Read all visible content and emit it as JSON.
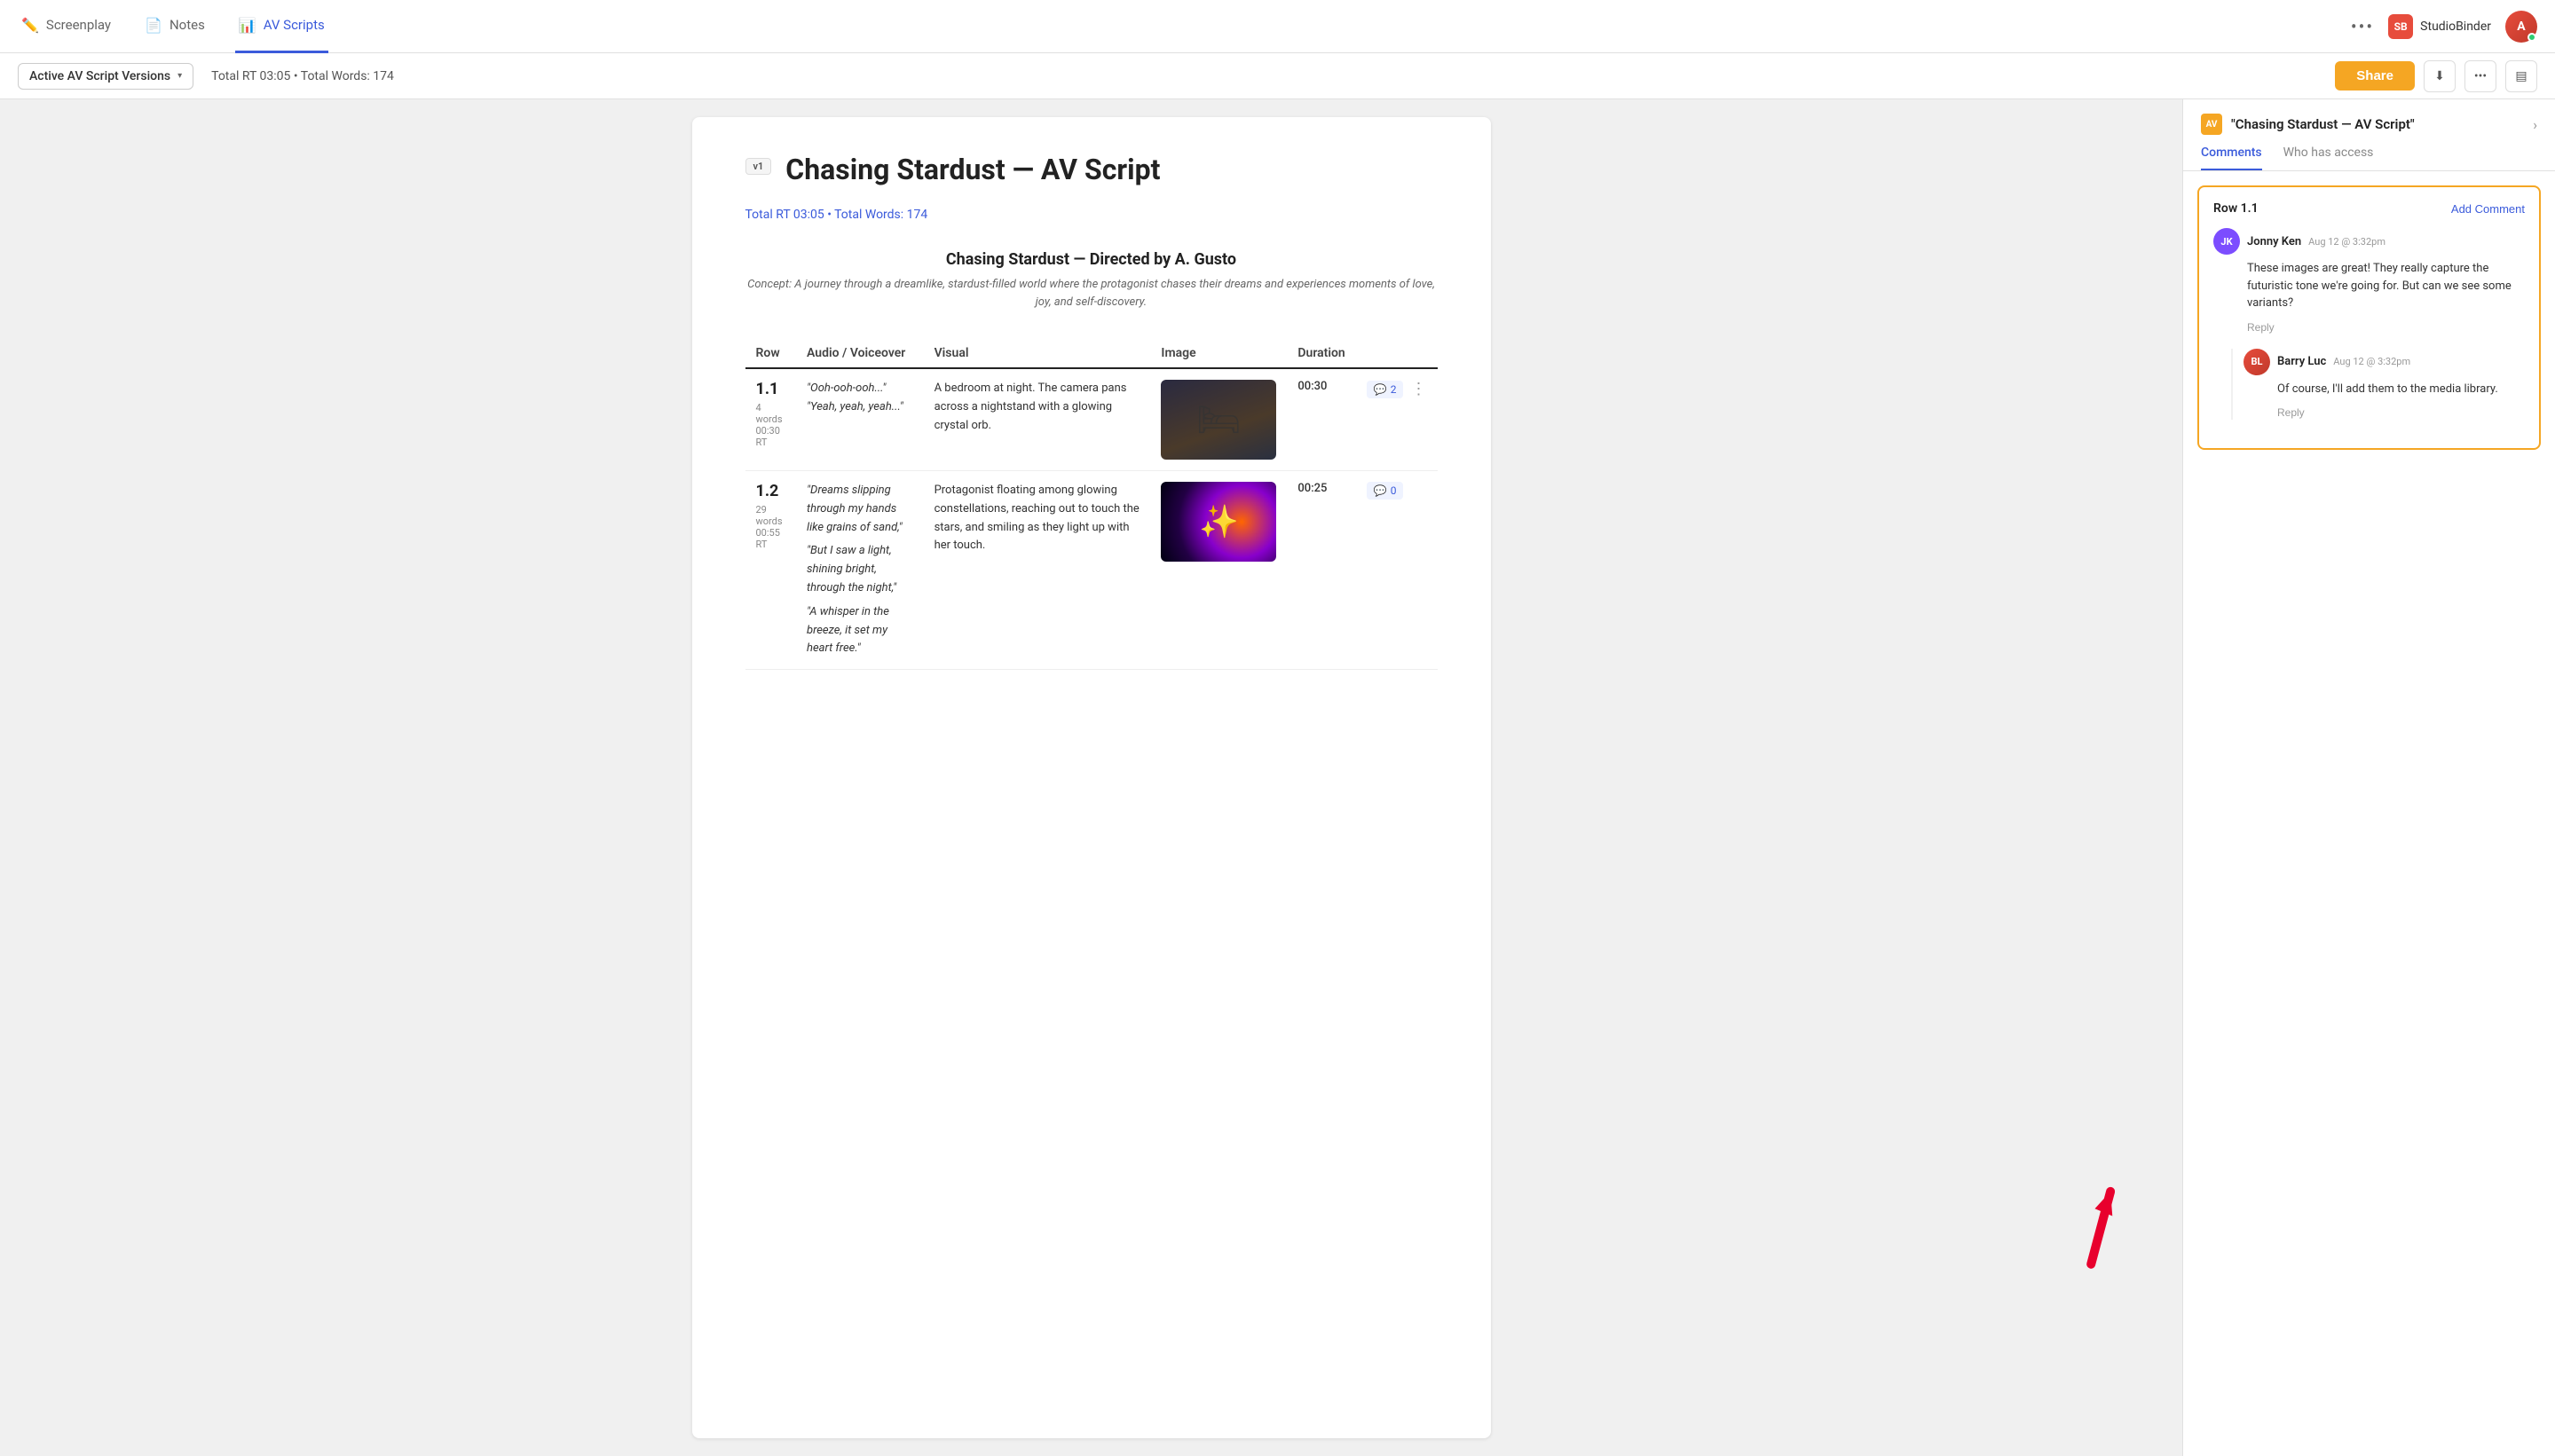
{
  "nav": {
    "tabs": [
      {
        "id": "screenplay",
        "label": "Screenplay",
        "icon": "✏️",
        "active": false
      },
      {
        "id": "notes",
        "label": "Notes",
        "icon": "📄",
        "active": false
      },
      {
        "id": "av-scripts",
        "label": "AV Scripts",
        "icon": "📊",
        "active": true
      }
    ],
    "more_label": "•••",
    "studio_binder_label": "StudioBinder"
  },
  "toolbar": {
    "version_label": "Active AV Script Versions",
    "rt_info": "Total RT 03:05 • Total Words: 174",
    "share_label": "Share",
    "download_icon": "⬇",
    "more_icon": "•••",
    "sidebar_icon": "▤"
  },
  "script": {
    "version_badge": "v1",
    "title": "Chasing Stardust — AV Script",
    "meta": "Total RT 03:05 • Total Words: 174",
    "subtitle_title": "Chasing Stardust — Directed by A. Gusto",
    "subtitle_concept": "Concept: A journey through a dreamlike, stardust-filled world where the protagonist chases their dreams and experiences\nmoments of love, joy, and self-discovery.",
    "table": {
      "headers": [
        "Row",
        "Audio / Voiceover",
        "Visual",
        "Image",
        "Duration"
      ],
      "rows": [
        {
          "row_num": "1.1",
          "row_meta": "4 words\n00:30 RT",
          "audio": "\"Ooh-ooh-ooh...\"\n\"Yeah, yeah, yeah...\"",
          "visual": "A bedroom at night. The camera pans across a nightstand with a glowing crystal orb.",
          "image_type": "bedroom",
          "duration": "00:30",
          "comments": 2
        },
        {
          "row_num": "1.2",
          "row_meta": "29 words\n00:55 RT",
          "audio": "\"Dreams slipping through my hands like grains of sand,\"\n\"But I saw a light, shining bright, through the night,\"\n\"A whisper in the breeze, it set my heart free.\"",
          "visual": "Protagonist floating among glowing constellations, reaching out to touch the stars, and smiling as they light up with her touch.",
          "image_type": "space",
          "duration": "00:25",
          "comments": 0
        }
      ]
    }
  },
  "right_panel": {
    "logo_text": "AV",
    "title": "\"Chasing Stardust — AV Script\"",
    "tabs": [
      {
        "id": "comments",
        "label": "Comments",
        "active": true
      },
      {
        "id": "who-has-access",
        "label": "Who has access",
        "active": false
      }
    ],
    "comment_section": {
      "row_label": "Row 1.1",
      "add_comment_label": "Add Comment",
      "comments": [
        {
          "author": "Jonny Ken",
          "avatar_initials": "JK",
          "time": "Aug 12 @ 3:32pm",
          "text": "These images are great! They really capture the futuristic tone we're going for. But can we see some variants?",
          "reply_label": "Reply"
        },
        {
          "author": "Barry Luc",
          "avatar_initials": "BL",
          "time": "Aug 12 @ 3:32pm",
          "text": "Of course, I'll add them to the media library.",
          "reply_label": "Reply",
          "is_reply": true
        }
      ]
    }
  }
}
